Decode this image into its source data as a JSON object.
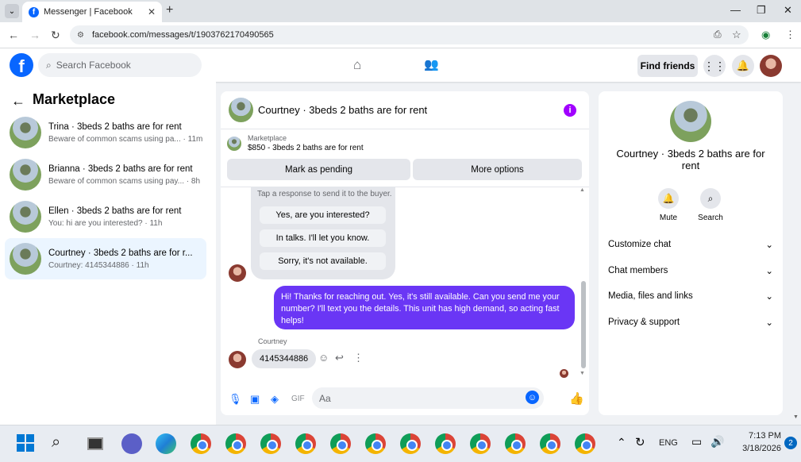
{
  "browser": {
    "tab_title": "Messenger | Facebook",
    "url": "facebook.com/messages/t/1903762170490565"
  },
  "fb_header": {
    "logo": "f",
    "search_placeholder": "Search Facebook",
    "find_friends": "Find friends"
  },
  "sidebar": {
    "title": "Marketplace",
    "conversations": [
      {
        "title": "Trina · 3beds 2 baths are for rent",
        "snippet": "Beware of common scams using pa... · 11m"
      },
      {
        "title": "Brianna · 3beds 2 baths are for rent",
        "snippet": "Beware of common scams using pay... · 8h"
      },
      {
        "title": "Ellen · 3beds 2 baths are for rent",
        "snippet": "You: hi are you interested? · 11h"
      },
      {
        "title": "Courtney · 3beds 2 baths are for r...",
        "snippet": "Courtney: 4145344886 · 11h"
      }
    ]
  },
  "chat": {
    "title": "Courtney · 3beds 2 baths are for rent",
    "marketplace_label": "Marketplace",
    "listing": "$850 - 3beds 2 baths are for rent",
    "mark_pending": "Mark as pending",
    "more_options": "More options",
    "quick_hint": "Tap a response to send it to the buyer.",
    "quick_replies": [
      "Yes, are you interested?",
      "In talks. I'll let you know.",
      "Sorry, it's not available."
    ],
    "my_message": "Hi! Thanks for reaching out. Yes, it's still available. Can you send me your number? I'll text you the details. This unit has high demand, so acting fast helps!",
    "sender": "Courtney",
    "their_message": "4145344886",
    "composer_placeholder": "Aa"
  },
  "details": {
    "name": "Courtney · 3beds 2 baths are for rent",
    "mute": "Mute",
    "search": "Search",
    "sections": [
      "Customize chat",
      "Chat members",
      "Media, files and links",
      "Privacy & support"
    ]
  },
  "taskbar": {
    "lang": "ENG",
    "time": "7:13 PM",
    "date": "3/18/2026",
    "notifications": "2"
  }
}
